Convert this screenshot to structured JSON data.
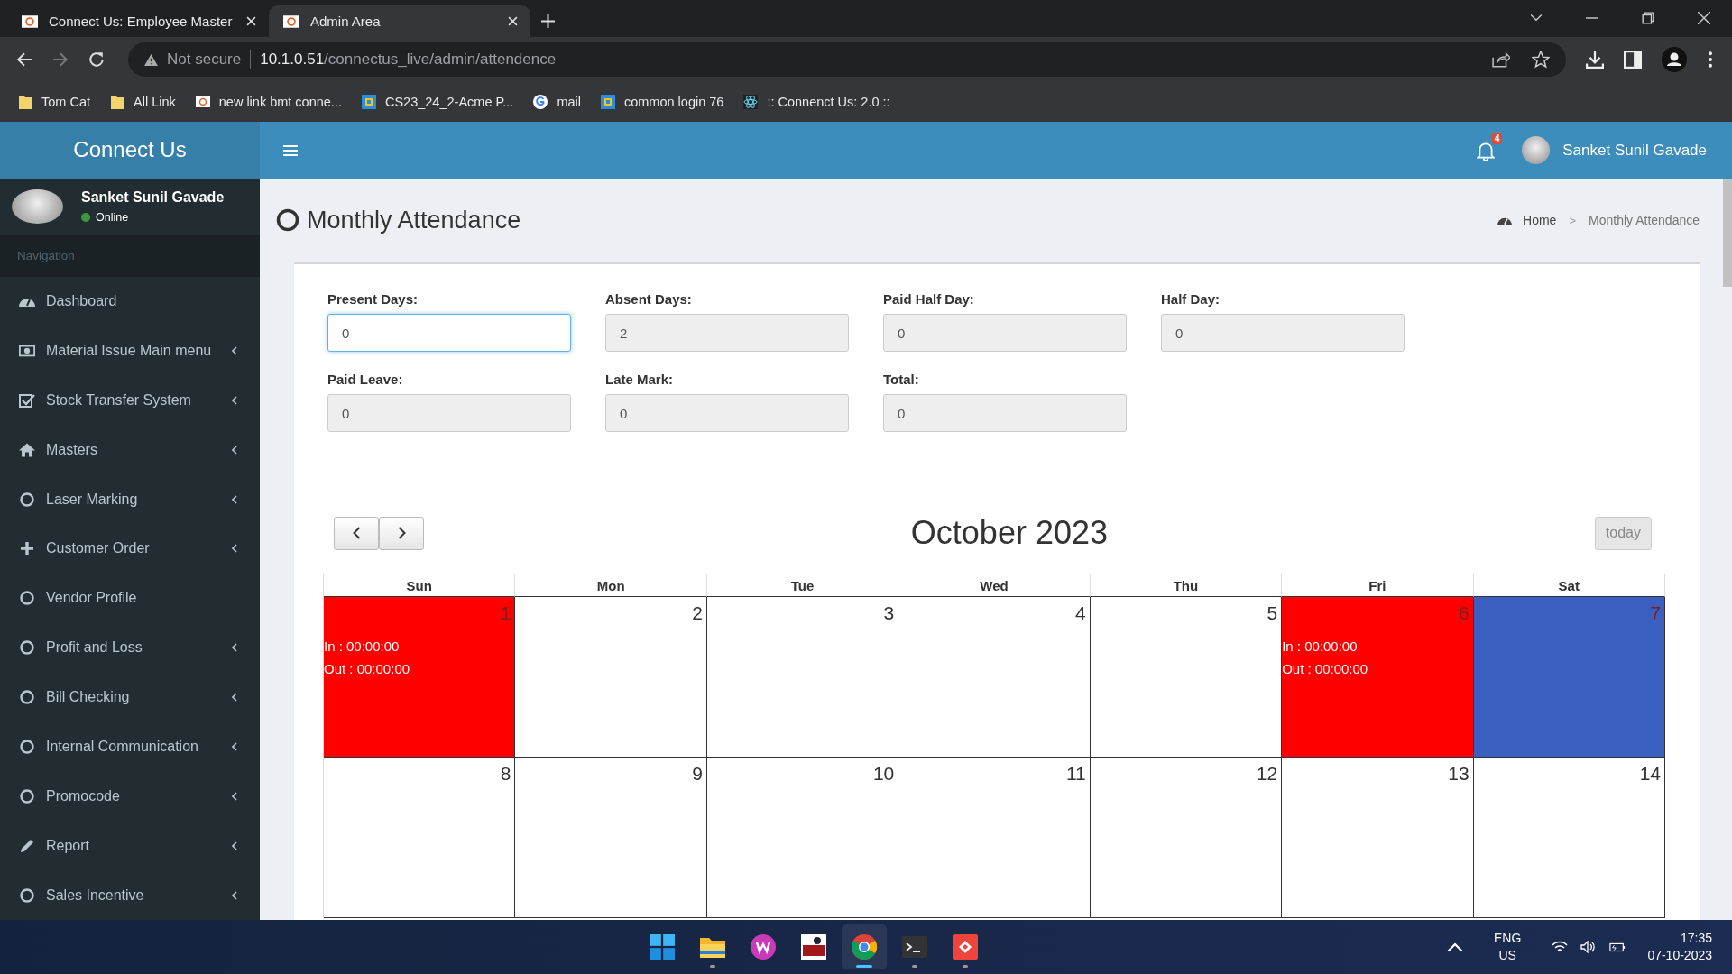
{
  "browser": {
    "tabs": [
      {
        "title": "Connect Us: Employee Master",
        "selected": false
      },
      {
        "title": "Admin Area",
        "selected": true
      }
    ],
    "address": {
      "security": "Not secure",
      "host": "10.1.0.51",
      "path": "/connectus_live/admin/attendence"
    },
    "bookmarks": [
      {
        "label": "Tom Cat",
        "kind": "folder"
      },
      {
        "label": "All Link",
        "kind": "folder"
      },
      {
        "label": "new link bmt conne...",
        "kind": "site"
      },
      {
        "label": "CS23_24_2-Acme P...",
        "kind": "grid"
      },
      {
        "label": "mail",
        "kind": "google"
      },
      {
        "label": "common login 76",
        "kind": "grid"
      },
      {
        "label": ":: Connenct Us: 2.0 ::",
        "kind": "atom"
      }
    ]
  },
  "app": {
    "logo": "Connect Us",
    "notification_count": "4",
    "user_name": "Sanket Sunil Gavade"
  },
  "sidebar": {
    "user_name": "Sanket Sunil Gavade",
    "status": "Online",
    "section": "Navigation",
    "items": [
      {
        "label": "Dashboard",
        "kind": "dashboard",
        "expandable": false
      },
      {
        "label": "Material Issue Main menu",
        "kind": "money",
        "expandable": true
      },
      {
        "label": "Stock Transfer System",
        "kind": "check",
        "expandable": true
      },
      {
        "label": "Masters",
        "kind": "home",
        "expandable": true
      },
      {
        "label": "Laser Marking",
        "kind": "circle",
        "expandable": true
      },
      {
        "label": "Customer Order",
        "kind": "plus",
        "expandable": true
      },
      {
        "label": "Vendor Profile",
        "kind": "circle",
        "expandable": false
      },
      {
        "label": "Profit and Loss",
        "kind": "circle",
        "expandable": true
      },
      {
        "label": "Bill Checking",
        "kind": "circle",
        "expandable": true
      },
      {
        "label": "Internal Communication",
        "kind": "circle",
        "expandable": true
      },
      {
        "label": "Promocode",
        "kind": "circle",
        "expandable": true
      },
      {
        "label": "Report",
        "kind": "pencil",
        "expandable": true
      },
      {
        "label": "Sales Incentive",
        "kind": "circle",
        "expandable": true
      }
    ]
  },
  "page": {
    "title": "Monthly Attendance",
    "breadcrumb_separator": ">",
    "breadcrumb": [
      {
        "label": "Home"
      },
      {
        "label": "Monthly Attendance"
      }
    ]
  },
  "stats": [
    {
      "label": "Present Days:",
      "value": "0",
      "focused": true
    },
    {
      "label": "Absent Days:",
      "value": "2",
      "focused": false
    },
    {
      "label": "Paid Half Day:",
      "value": "0",
      "focused": false
    },
    {
      "label": "Half Day:",
      "value": "0",
      "focused": false
    },
    {
      "label": "Paid Leave:",
      "value": "0",
      "focused": false
    },
    {
      "label": "Late Mark:",
      "value": "0",
      "focused": false
    },
    {
      "label": "Total:",
      "value": "0",
      "focused": false
    }
  ],
  "calendar": {
    "title": "October 2023",
    "today_button": "today",
    "weekdays": [
      "Sun",
      "Mon",
      "Tue",
      "Wed",
      "Thu",
      "Fri",
      "Sat"
    ],
    "weeks": [
      [
        {
          "day": "1",
          "color": "#ff0000",
          "in_time": "In : 00:00:00",
          "out_time": "Out : 00:00:00"
        },
        {
          "day": "2"
        },
        {
          "day": "3"
        },
        {
          "day": "4"
        },
        {
          "day": "5"
        },
        {
          "day": "6",
          "color": "#ff0000",
          "in_time": "In : 00:00:00",
          "out_time": "Out : 00:00:00"
        },
        {
          "day": "7",
          "color": "#3a5fc0"
        }
      ],
      [
        {
          "day": "8"
        },
        {
          "day": "9"
        },
        {
          "day": "10"
        },
        {
          "day": "11"
        },
        {
          "day": "12"
        },
        {
          "day": "13"
        },
        {
          "day": "14"
        }
      ]
    ]
  },
  "taskbar": {
    "apps": [
      {
        "kind": "start",
        "running": false,
        "selected": false
      },
      {
        "kind": "folder",
        "running": true,
        "selected": false
      },
      {
        "kind": "office",
        "running": false,
        "selected": false
      },
      {
        "kind": "vnc",
        "running": false,
        "selected": false
      },
      {
        "kind": "chrome",
        "running": true,
        "selected": true
      },
      {
        "kind": "terminal",
        "running": true,
        "selected": false
      },
      {
        "kind": "remote",
        "running": true,
        "selected": false
      }
    ],
    "language": "ENG",
    "region": "US",
    "time": "17:35",
    "date": "07-10-2023"
  }
}
